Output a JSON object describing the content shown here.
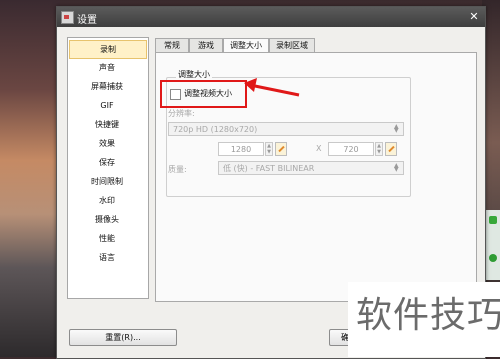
{
  "window": {
    "title": "设置"
  },
  "sidebar": {
    "items": [
      {
        "label": "录制",
        "selected": true
      },
      {
        "label": "声音"
      },
      {
        "label": "屏幕捕获"
      },
      {
        "label": "GIF"
      },
      {
        "label": "快捷键"
      },
      {
        "label": "效果"
      },
      {
        "label": "保存"
      },
      {
        "label": "时间限制"
      },
      {
        "label": "水印"
      },
      {
        "label": "摄像头"
      },
      {
        "label": "性能"
      },
      {
        "label": "语言"
      }
    ]
  },
  "tabs": [
    {
      "label": "常规"
    },
    {
      "label": "游戏"
    },
    {
      "label": "调整大小",
      "active": true
    },
    {
      "label": "录制区域"
    }
  ],
  "resize": {
    "group_title": "调整大小",
    "checkbox_label": "调整视频大小",
    "checkbox_checked": false,
    "resolution_label": "分辨率:",
    "resolution_value": "720p HD (1280x720)",
    "width_value": "1280",
    "times_symbol": "X",
    "height_value": "720",
    "quality_label": "质量:",
    "quality_value": "低 (快) - FAST BILINEAR"
  },
  "buttons": {
    "reset_label": "重置(R)...",
    "ok_label": "确"
  },
  "watermark": {
    "text": "软件技巧"
  },
  "colors": {
    "highlight": "#e01818",
    "selected_bg": "#fff1c8"
  },
  "icons": [
    "app-icon",
    "close-icon",
    "checkbox",
    "dropdown-arrow-icon",
    "spin-icon",
    "aspect-ratio-icon",
    "arrow-annotation"
  ]
}
